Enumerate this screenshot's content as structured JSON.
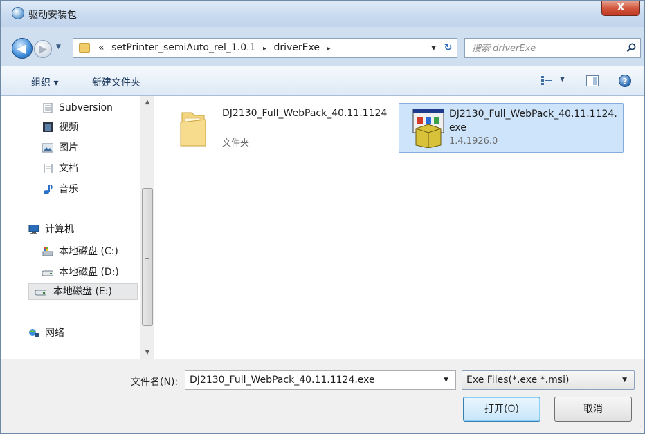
{
  "window": {
    "title": "驱动安装包",
    "close_label": "X"
  },
  "address_bar": {
    "overflow": "«",
    "crumbs": [
      "setPrinter_semiAuto_rel_1.0.1",
      "driverExe"
    ],
    "separator": "▸",
    "search_placeholder": "搜索 driverExe"
  },
  "toolbar": {
    "organize": "组织 ▾",
    "new_folder": "新建文件夹"
  },
  "nav": {
    "items": [
      {
        "label": "Subversion",
        "icon": "subversion-icon"
      },
      {
        "label": "视频",
        "icon": "video-icon"
      },
      {
        "label": "图片",
        "icon": "pictures-icon"
      },
      {
        "label": "文档",
        "icon": "documents-icon"
      },
      {
        "label": "音乐",
        "icon": "music-icon"
      },
      {
        "label": "计算机",
        "icon": "computer-icon"
      },
      {
        "label": "本地磁盘 (C:)",
        "icon": "system-drive-icon"
      },
      {
        "label": "本地磁盘 (D:)",
        "icon": "drive-icon"
      },
      {
        "label": "本地磁盘 (E:)",
        "icon": "drive-icon"
      },
      {
        "label": "网络",
        "icon": "network-icon"
      }
    ]
  },
  "files": [
    {
      "name": "DJ2130_Full_WebPack_40.11.1124",
      "sub": "文件夹",
      "icon": "folder-icon"
    },
    {
      "name": "DJ2130_Full_WebPack_40.11.1124.exe",
      "sub": "1.4.1926.0",
      "icon": "installer-icon"
    }
  ],
  "footer": {
    "filename_label_pre": "文件名(",
    "filename_label_key": "N",
    "filename_label_post": "):",
    "filename_value": "DJ2130_Full_WebPack_40.11.1124.exe",
    "filter_value": "Exe Files(*.exe *.msi)",
    "open_label": "打开(O)",
    "cancel_label": "取消"
  },
  "colors": {
    "selection": "#cde4fb",
    "chrome": "#cfdff0",
    "close": "#c13a22"
  }
}
